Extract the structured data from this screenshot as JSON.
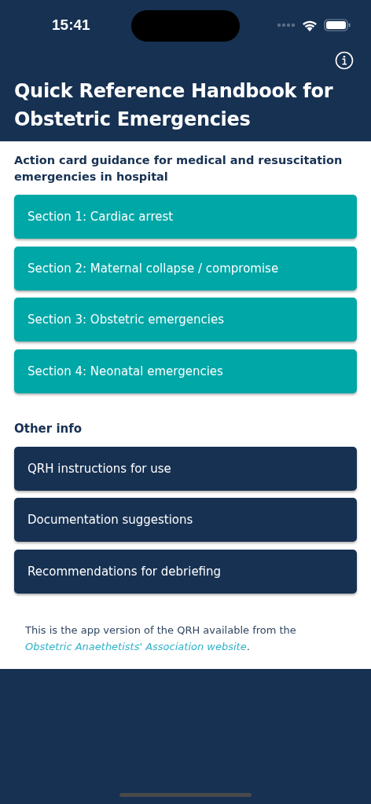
{
  "status_bar": {
    "time": "15:41"
  },
  "header": {
    "title": "Quick Reference Handbook for Obstetric Emergencies"
  },
  "subtitle": "Action card guidance for medical and resuscitation emergencies in hospital",
  "sections": [
    {
      "label": "Section 1: Cardiac arrest"
    },
    {
      "label": "Section 2: Maternal collapse / compromise"
    },
    {
      "label": "Section 3: Obstetric emergencies"
    },
    {
      "label": "Section 4: Neonatal emergencies"
    }
  ],
  "other_info": {
    "heading": "Other info",
    "items": [
      {
        "label": "QRH instructions for use"
      },
      {
        "label": "Documentation suggestions"
      },
      {
        "label": "Recommendations for debriefing"
      }
    ]
  },
  "footer": {
    "text": "This is the app version of the QRH available from the",
    "link": "Obstetric Anaethetists' Association website",
    "suffix": "."
  }
}
